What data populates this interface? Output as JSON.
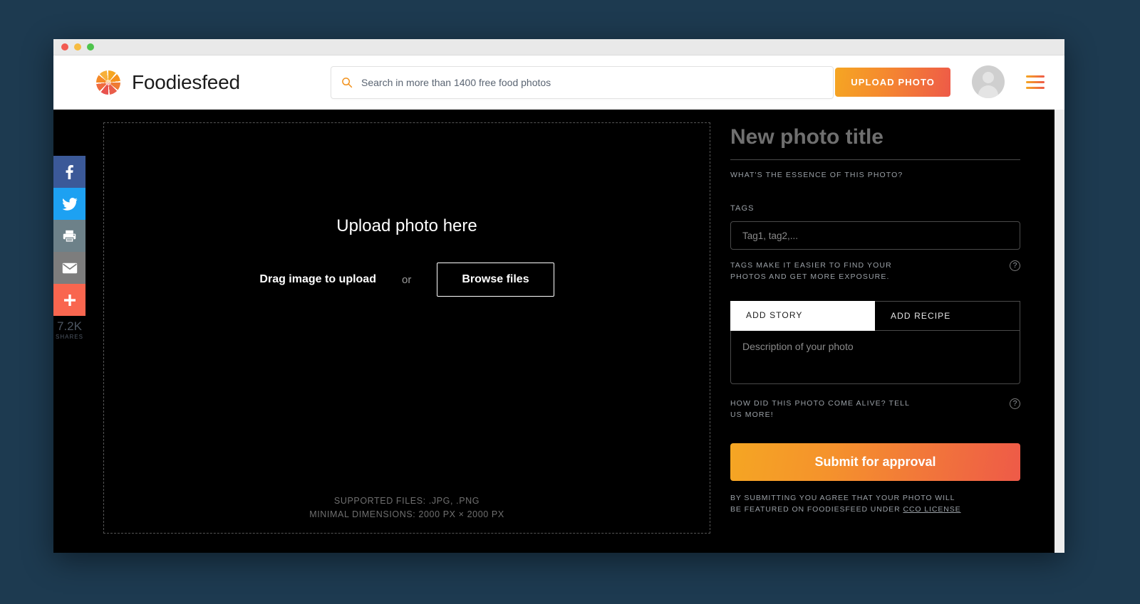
{
  "window": {
    "traffic_lights": [
      "close",
      "minimize",
      "maximize"
    ]
  },
  "header": {
    "brand_name": "Foodiesfeed",
    "logo_icon": "aperture-icon",
    "search": {
      "icon": "search-icon",
      "placeholder": "Search in more than 1400 free food photos",
      "value": ""
    },
    "upload_button": "UPLOAD PHOTO",
    "avatar_icon": "user-avatar-icon",
    "menu_icon": "hamburger-menu-icon"
  },
  "social_rail": {
    "buttons": [
      {
        "name": "facebook",
        "icon": "facebook-icon",
        "color": "#3b5998"
      },
      {
        "name": "twitter",
        "icon": "twitter-icon",
        "color": "#1da1f2"
      },
      {
        "name": "print",
        "icon": "printer-icon",
        "color": "#6d8189"
      },
      {
        "name": "email",
        "icon": "envelope-icon",
        "color": "#7d7d7d"
      },
      {
        "name": "more",
        "icon": "plus-icon",
        "color": "#f9664f"
      }
    ],
    "share_count": "7.2K",
    "share_label": "SHARES"
  },
  "dropzone": {
    "title": "Upload photo here",
    "drag_text": "Drag image to upload",
    "or_text": "or",
    "browse_button": "Browse files",
    "supported_files": "SUPPORTED FILES: .JPG, .PNG",
    "minimal_dimensions": "MINIMAL DIMENSIONS: 2000 PX × 2000 PX"
  },
  "form": {
    "title_placeholder": "New photo title",
    "title_value": "",
    "title_hint": "WHAT'S THE ESSENCE OF THIS PHOTO?",
    "tags_label": "TAGS",
    "tags_placeholder": "Tag1, tag2,...",
    "tags_value": "",
    "tags_hint": "TAGS MAKE IT EASIER TO FIND YOUR PHOTOS AND GET MORE EXPOSURE.",
    "tags_help_icon": "question-mark-icon",
    "tabs": [
      {
        "label": "ADD STORY",
        "active": true
      },
      {
        "label": "ADD RECIPE",
        "active": false
      }
    ],
    "description_placeholder": "Description of your photo",
    "description_value": "",
    "description_hint": "HOW DID THIS PHOTO COME ALIVE? TELL US MORE!",
    "description_help_icon": "question-mark-icon",
    "submit_button": "Submit for approval",
    "legal_line1": "BY SUBMITTING YOU AGREE THAT YOUR PHOTO WILL",
    "legal_line2_pre": "BE FEATURED ON FOODIESFEED UNDER ",
    "legal_link": "CCO LICENSE"
  },
  "colors": {
    "page_background": "#1d3a50",
    "app_background": "#000000",
    "accent_orange": "#f5a623",
    "accent_red": "#ee5a48",
    "muted_text": "#9aa0a6"
  }
}
